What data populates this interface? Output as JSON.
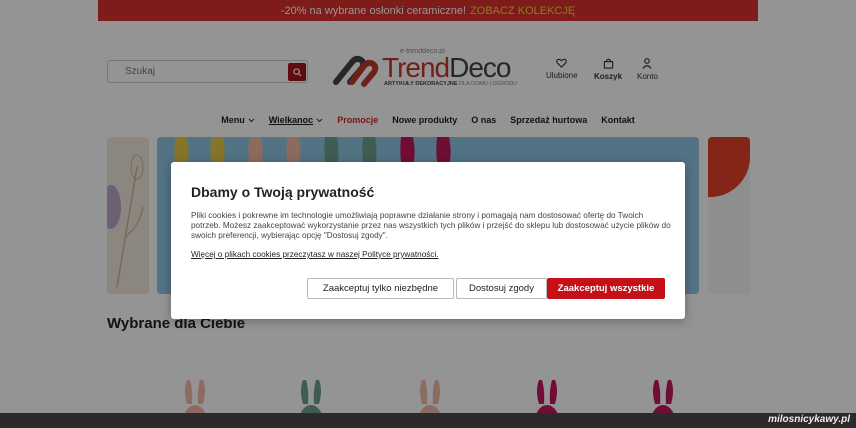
{
  "promo_bar": {
    "text": "-20% na wybrane osłonki ceramiczne!",
    "cta": "ZOBACZ KOLEKCJĘ"
  },
  "header": {
    "search_placeholder": "Szukaj",
    "logo": {
      "domain": "e-trenddeco.pl",
      "name_part1": "Trend",
      "name_part2": "Deco",
      "tagline_bold": "ARTYKUŁY DEKORACYJNE",
      "tagline_light": "DLA DOMU I OGRODU"
    },
    "icons": [
      {
        "label": "Ulubione",
        "icon": "heart-icon"
      },
      {
        "label": "Koszyk",
        "icon": "bag-icon"
      },
      {
        "label": "Konto",
        "icon": "user-icon"
      }
    ]
  },
  "nav": {
    "items": [
      {
        "label": "Menu",
        "dropdown": true
      },
      {
        "label": "Wielkanoc",
        "dropdown": true
      },
      {
        "label": "Promocje"
      },
      {
        "label": "Nowe produkty"
      },
      {
        "label": "O nas"
      },
      {
        "label": "Sprzedaż hurtowa"
      },
      {
        "label": "Kontakt"
      }
    ]
  },
  "section": {
    "title": "Wybrane dla Ciebie"
  },
  "cookie_modal": {
    "title": "Dbamy o Twoją prywatność",
    "body": "Pliki cookies i pokrewne im technologie umożliwiają poprawne działanie strony i pomagają nam dostosować ofertę do Twoich potrzeb. Możesz zaakceptować wykorzystanie przez nas wszystkich tych plików i przejść do sklepu lub dostosować użycie plików do swoich preferencji, wybierając opcję \"Dostosuj zgody\".",
    "link": "Więcej o plikach cookies przeczytasz w naszej Polityce prywatności.",
    "buttons": {
      "necessary": "Zaakceptuj tylko niezbędne",
      "customize": "Dostosuj zgody",
      "accept_all": "Zaakceptuj wszystkie"
    }
  },
  "watermark": "milosnicykawy.pl",
  "colors": {
    "promo_bg": "#d9312e",
    "brand_red": "#c5101a",
    "cta_yellow": "#f6d437"
  }
}
